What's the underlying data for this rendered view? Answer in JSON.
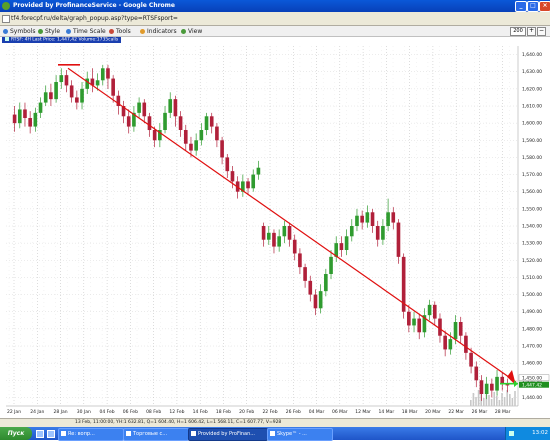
{
  "window": {
    "title": "Provided by ProfinanceService - Google Chrome",
    "url": "tf4.forecpf.ru/delta/graph_popup.asp?type=RTSFsport=",
    "controls": [
      "_",
      "□",
      "×"
    ]
  },
  "toolbar": {
    "items": [
      {
        "label": "Symbols",
        "icon": "symbols-icon"
      },
      {
        "label": "Style",
        "icon": "style-icon"
      },
      {
        "label": "Time Scale",
        "icon": "clock-icon"
      },
      {
        "label": "Tools",
        "icon": "tools-icon"
      },
      {
        "label": "Indicators",
        "icon": "indicators-icon"
      },
      {
        "label": "View",
        "icon": "view-icon"
      }
    ],
    "zoom_value": "200"
  },
  "legend": "RTSF: 4H Last Price: 1,447,42 Volume:1735calls",
  "chart_data": {
    "type": "candlestick",
    "y_ticks": [
      "1,640.00",
      "1,630.00",
      "1,620.00",
      "1,610.00",
      "1,600.00",
      "1,590.00",
      "1,580.00",
      "1,570.00",
      "1,560.00",
      "1,550.00",
      "1,540.00",
      "1,530.00",
      "1,520.00",
      "1,510.00",
      "1,500.00",
      "1,490.00",
      "1,480.00",
      "1,470.00",
      "1,460.00",
      "1,450.00",
      "1,440.00"
    ],
    "x_ticks": [
      "22 Jan",
      "24 Jan",
      "28 Jan",
      "30 Jan",
      "04 Feb",
      "06 Feb",
      "08 Feb",
      "12 Feb",
      "14 Feb",
      "18 Feb",
      "20 Feb",
      "22 Feb",
      "26 Feb",
      "04 Mar",
      "06 Mar",
      "12 Mar",
      "14 Mar",
      "18 Mar",
      "20 Mar",
      "22 Mar",
      "26 Mar",
      "28 Mar"
    ],
    "price_labels": [
      "1,447.42",
      "1,450.00"
    ],
    "candles": [
      {
        "o": 1605,
        "c": 1600,
        "h": 1610,
        "l": 1595
      },
      {
        "o": 1600,
        "c": 1608,
        "h": 1612,
        "l": 1597
      },
      {
        "o": 1608,
        "c": 1603,
        "h": 1612,
        "l": 1598
      },
      {
        "o": 1603,
        "c": 1598,
        "h": 1607,
        "l": 1594
      },
      {
        "o": 1598,
        "c": 1606,
        "h": 1609,
        "l": 1595
      },
      {
        "o": 1606,
        "c": 1612,
        "h": 1615,
        "l": 1603
      },
      {
        "o": 1612,
        "c": 1618,
        "h": 1622,
        "l": 1610
      },
      {
        "o": 1618,
        "c": 1614,
        "h": 1623,
        "l": 1610
      },
      {
        "o": 1614,
        "c": 1624,
        "h": 1628,
        "l": 1612
      },
      {
        "o": 1624,
        "c": 1628,
        "h": 1632,
        "l": 1620
      },
      {
        "o": 1628,
        "c": 1622,
        "h": 1631,
        "l": 1618
      },
      {
        "o": 1622,
        "c": 1615,
        "h": 1625,
        "l": 1612
      },
      {
        "o": 1615,
        "c": 1612,
        "h": 1619,
        "l": 1608
      },
      {
        "o": 1612,
        "c": 1620,
        "h": 1624,
        "l": 1608
      },
      {
        "o": 1620,
        "c": 1626,
        "h": 1630,
        "l": 1617
      },
      {
        "o": 1626,
        "c": 1622,
        "h": 1632,
        "l": 1618
      },
      {
        "o": 1622,
        "c": 1625,
        "h": 1629,
        "l": 1619
      },
      {
        "o": 1625,
        "c": 1632,
        "h": 1634,
        "l": 1622
      },
      {
        "o": 1632,
        "c": 1626,
        "h": 1634,
        "l": 1620
      },
      {
        "o": 1626,
        "c": 1616,
        "h": 1628,
        "l": 1612
      },
      {
        "o": 1616,
        "c": 1610,
        "h": 1619,
        "l": 1605
      },
      {
        "o": 1610,
        "c": 1604,
        "h": 1613,
        "l": 1600
      },
      {
        "o": 1604,
        "c": 1598,
        "h": 1608,
        "l": 1594
      },
      {
        "o": 1598,
        "c": 1606,
        "h": 1610,
        "l": 1595
      },
      {
        "o": 1606,
        "c": 1612,
        "h": 1615,
        "l": 1603
      },
      {
        "o": 1612,
        "c": 1604,
        "h": 1614,
        "l": 1600
      },
      {
        "o": 1604,
        "c": 1596,
        "h": 1606,
        "l": 1592
      },
      {
        "o": 1596,
        "c": 1590,
        "h": 1598,
        "l": 1586
      },
      {
        "o": 1590,
        "c": 1596,
        "h": 1600,
        "l": 1586
      },
      {
        "o": 1596,
        "c": 1606,
        "h": 1610,
        "l": 1594
      },
      {
        "o": 1606,
        "c": 1614,
        "h": 1618,
        "l": 1603
      },
      {
        "o": 1614,
        "c": 1604,
        "h": 1616,
        "l": 1598
      },
      {
        "o": 1604,
        "c": 1596,
        "h": 1607,
        "l": 1592
      },
      {
        "o": 1596,
        "c": 1588,
        "h": 1599,
        "l": 1584
      },
      {
        "o": 1588,
        "c": 1584,
        "h": 1592,
        "l": 1580
      },
      {
        "o": 1584,
        "c": 1590,
        "h": 1594,
        "l": 1581
      },
      {
        "o": 1590,
        "c": 1596,
        "h": 1600,
        "l": 1587
      },
      {
        "o": 1596,
        "c": 1604,
        "h": 1606,
        "l": 1593
      },
      {
        "o": 1604,
        "c": 1598,
        "h": 1606,
        "l": 1594
      },
      {
        "o": 1598,
        "c": 1590,
        "h": 1600,
        "l": 1586
      },
      {
        "o": 1590,
        "c": 1580,
        "h": 1592,
        "l": 1576
      },
      {
        "o": 1580,
        "c": 1572,
        "h": 1582,
        "l": 1568
      },
      {
        "o": 1572,
        "c": 1566,
        "h": 1575,
        "l": 1562
      },
      {
        "o": 1566,
        "c": 1560,
        "h": 1569,
        "l": 1556
      },
      {
        "o": 1560,
        "c": 1566,
        "h": 1570,
        "l": 1557
      },
      {
        "o": 1566,
        "c": 1562,
        "h": 1568,
        "l": 1558
      },
      {
        "o": 1562,
        "c": 1570,
        "h": 1573,
        "l": 1560
      },
      {
        "o": 1570,
        "c": 1574,
        "h": 1578,
        "l": 1567
      },
      {
        "o": 1540,
        "c": 1532,
        "h": 1542,
        "l": 1528
      },
      {
        "o": 1532,
        "c": 1536,
        "h": 1540,
        "l": 1529
      },
      {
        "o": 1536,
        "c": 1528,
        "h": 1538,
        "l": 1524
      },
      {
        "o": 1528,
        "c": 1534,
        "h": 1538,
        "l": 1525
      },
      {
        "o": 1534,
        "c": 1540,
        "h": 1543,
        "l": 1530
      },
      {
        "o": 1540,
        "c": 1532,
        "h": 1542,
        "l": 1528
      },
      {
        "o": 1532,
        "c": 1524,
        "h": 1535,
        "l": 1520
      },
      {
        "o": 1524,
        "c": 1516,
        "h": 1527,
        "l": 1512
      },
      {
        "o": 1516,
        "c": 1508,
        "h": 1518,
        "l": 1504
      },
      {
        "o": 1508,
        "c": 1500,
        "h": 1511,
        "l": 1496
      },
      {
        "o": 1500,
        "c": 1492,
        "h": 1503,
        "l": 1488
      },
      {
        "o": 1492,
        "c": 1502,
        "h": 1506,
        "l": 1489
      },
      {
        "o": 1502,
        "c": 1512,
        "h": 1515,
        "l": 1499
      },
      {
        "o": 1512,
        "c": 1522,
        "h": 1526,
        "l": 1509
      },
      {
        "o": 1522,
        "c": 1530,
        "h": 1534,
        "l": 1519
      },
      {
        "o": 1530,
        "c": 1526,
        "h": 1534,
        "l": 1522
      },
      {
        "o": 1526,
        "c": 1534,
        "h": 1538,
        "l": 1523
      },
      {
        "o": 1534,
        "c": 1540,
        "h": 1544,
        "l": 1531
      },
      {
        "o": 1540,
        "c": 1546,
        "h": 1550,
        "l": 1537
      },
      {
        "o": 1546,
        "c": 1542,
        "h": 1549,
        "l": 1538
      },
      {
        "o": 1542,
        "c": 1548,
        "h": 1552,
        "l": 1539
      },
      {
        "o": 1548,
        "c": 1540,
        "h": 1550,
        "l": 1536
      },
      {
        "o": 1540,
        "c": 1532,
        "h": 1543,
        "l": 1528
      },
      {
        "o": 1532,
        "c": 1540,
        "h": 1544,
        "l": 1529
      },
      {
        "o": 1540,
        "c": 1548,
        "h": 1556,
        "l": 1537
      },
      {
        "o": 1548,
        "c": 1542,
        "h": 1551,
        "l": 1538
      },
      {
        "o": 1542,
        "c": 1522,
        "h": 1544,
        "l": 1518
      },
      {
        "o": 1522,
        "c": 1490,
        "h": 1524,
        "l": 1486
      },
      {
        "o": 1490,
        "c": 1482,
        "h": 1494,
        "l": 1478
      },
      {
        "o": 1482,
        "c": 1486,
        "h": 1490,
        "l": 1478
      },
      {
        "o": 1486,
        "c": 1478,
        "h": 1489,
        "l": 1474
      },
      {
        "o": 1478,
        "c": 1488,
        "h": 1492,
        "l": 1475
      },
      {
        "o": 1488,
        "c": 1494,
        "h": 1497,
        "l": 1485
      },
      {
        "o": 1494,
        "c": 1486,
        "h": 1496,
        "l": 1482
      },
      {
        "o": 1486,
        "c": 1476,
        "h": 1489,
        "l": 1472
      },
      {
        "o": 1476,
        "c": 1468,
        "h": 1479,
        "l": 1464
      },
      {
        "o": 1468,
        "c": 1474,
        "h": 1478,
        "l": 1465
      },
      {
        "o": 1474,
        "c": 1484,
        "h": 1488,
        "l": 1471
      },
      {
        "o": 1484,
        "c": 1476,
        "h": 1487,
        "l": 1472
      },
      {
        "o": 1476,
        "c": 1466,
        "h": 1478,
        "l": 1462
      },
      {
        "o": 1466,
        "c": 1458,
        "h": 1469,
        "l": 1454
      },
      {
        "o": 1458,
        "c": 1450,
        "h": 1461,
        "l": 1446
      },
      {
        "o": 1450,
        "c": 1442,
        "h": 1453,
        "l": 1438
      },
      {
        "o": 1442,
        "c": 1448,
        "h": 1452,
        "l": 1439
      },
      {
        "o": 1448,
        "c": 1444,
        "h": 1451,
        "l": 1440
      },
      {
        "o": 1444,
        "c": 1452,
        "h": 1456,
        "l": 1441
      },
      {
        "o": 1452,
        "c": 1448,
        "h": 1455,
        "l": 1444
      },
      {
        "o": 1448,
        "c": 1447,
        "h": 1451,
        "l": 1443
      }
    ]
  },
  "status_text": "13 Feb, 11:00:00, YH:1 632.81, Q=1 604.40, H=1 606.42, L=1 568.11, C=1 607.77, V=928",
  "taskbar": {
    "start_label": "Пуск",
    "tasks": [
      {
        "label": "Re: вопр...",
        "active": false
      },
      {
        "label": "Торговые с...",
        "active": false
      },
      {
        "label": "Provided by ProFinan...",
        "active": true
      },
      {
        "label": "Skype™ - ...",
        "active": false
      }
    ],
    "time": "13:02"
  },
  "colors": {
    "up": "#2f9b2f",
    "down": "#b0203a",
    "trend": "#e01010",
    "marker_green": "#2fd02f"
  }
}
